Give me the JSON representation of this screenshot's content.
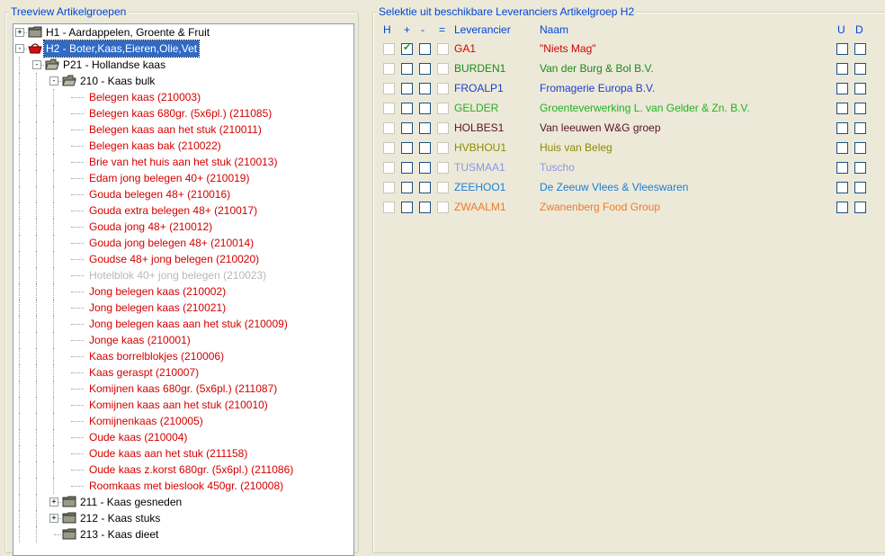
{
  "left_panel": {
    "legend": "Treeview Artikelgroepen",
    "tree": [
      {
        "label": "H1  - Aardappelen, Groente & Fruit",
        "level": 0,
        "expander": "+",
        "icon": "folder-icon",
        "color": "#000000",
        "selected": false
      },
      {
        "label": "H2  - Boter,Kaas,Eieren,Olie,Vet",
        "level": 0,
        "expander": "−",
        "icon": "red-basket-icon",
        "color": "#ffffff",
        "selected": true
      },
      {
        "label": "P21 - Hollandse kaas",
        "level": 1,
        "expander": "−",
        "icon": "open-folder-icon",
        "color": "#000000",
        "selected": false
      },
      {
        "label": "210 - Kaas bulk",
        "level": 2,
        "expander": "−",
        "icon": "open-folder-icon",
        "color": "#000000",
        "selected": false
      },
      {
        "label": "Belegen kaas (210003)",
        "level": 3,
        "color": "#d40000"
      },
      {
        "label": "Belegen kaas 680gr. (5x6pl.) (211085)",
        "level": 3,
        "color": "#d40000"
      },
      {
        "label": "Belegen kaas aan het stuk (210011)",
        "level": 3,
        "color": "#d40000"
      },
      {
        "label": "Belegen kaas bak (210022)",
        "level": 3,
        "color": "#d40000"
      },
      {
        "label": "Brie van het huis aan het stuk (210013)",
        "level": 3,
        "color": "#d40000"
      },
      {
        "label": "Edam jong belegen 40+ (210019)",
        "level": 3,
        "color": "#d40000"
      },
      {
        "label": "Gouda belegen 48+ (210016)",
        "level": 3,
        "color": "#d40000"
      },
      {
        "label": "Gouda extra belegen 48+ (210017)",
        "level": 3,
        "color": "#d40000"
      },
      {
        "label": "Gouda jong 48+ (210012)",
        "level": 3,
        "color": "#d40000"
      },
      {
        "label": "Gouda jong belegen 48+ (210014)",
        "level": 3,
        "color": "#d40000"
      },
      {
        "label": "Goudse 48+ jong belegen (210020)",
        "level": 3,
        "color": "#d40000"
      },
      {
        "label": "Hotelblok 40+ jong belegen (210023)",
        "level": 3,
        "color": "#b8b8b8"
      },
      {
        "label": "Jong belegen kaas (210002)",
        "level": 3,
        "color": "#d40000"
      },
      {
        "label": "Jong belegen kaas (210021)",
        "level": 3,
        "color": "#d40000"
      },
      {
        "label": "Jong belegen kaas aan het stuk (210009)",
        "level": 3,
        "color": "#d40000"
      },
      {
        "label": "Jonge kaas (210001)",
        "level": 3,
        "color": "#d40000"
      },
      {
        "label": "Kaas borrelblokjes (210006)",
        "level": 3,
        "color": "#d40000"
      },
      {
        "label": "Kaas geraspt (210007)",
        "level": 3,
        "color": "#d40000"
      },
      {
        "label": "Komijnen kaas 680gr. (5x6pl.) (211087)",
        "level": 3,
        "color": "#d40000"
      },
      {
        "label": "Komijnen kaas aan het stuk (210010)",
        "level": 3,
        "color": "#d40000"
      },
      {
        "label": "Komijnenkaas (210005)",
        "level": 3,
        "color": "#d40000"
      },
      {
        "label": "Oude kaas (210004)",
        "level": 3,
        "color": "#d40000"
      },
      {
        "label": "Oude kaas aan het stuk (211158)",
        "level": 3,
        "color": "#d40000"
      },
      {
        "label": "Oude kaas z.korst 680gr. (5x6pl.) (211086)",
        "level": 3,
        "color": "#d40000"
      },
      {
        "label": "Roomkaas met bieslook 450gr. (210008)",
        "level": 3,
        "color": "#d40000"
      },
      {
        "label": "211 - Kaas gesneden",
        "level": 2,
        "expander": "+",
        "icon": "folder-icon",
        "color": "#000000",
        "selected": false
      },
      {
        "label": "212 - Kaas stuks",
        "level": 2,
        "expander": "+",
        "icon": "folder-icon",
        "color": "#000000",
        "selected": false
      },
      {
        "label": "213 - Kaas dieet",
        "level": 2,
        "icon": "folder-icon",
        "color": "#000000",
        "selected": false
      }
    ]
  },
  "right_panel": {
    "legend": "Selektie uit beschikbare Leveranciers Artikelgroep H2",
    "columns": {
      "h": "H",
      "plus": "+",
      "minus": "-",
      "eq": "=",
      "leverancier": "Leverancier",
      "naam": "Naam",
      "u": "U",
      "d": "D"
    },
    "rows": [
      {
        "code": "GA1",
        "naam": "\"Niets Mag\"",
        "color": "#d40000",
        "plus_checked": true
      },
      {
        "code": "BURDEN1",
        "naam": "Van der Burg & Bol B.V.",
        "color": "#1a8c1a",
        "plus_checked": false
      },
      {
        "code": "FROALP1",
        "naam": "Fromagerie Europa B.V.",
        "color": "#1c3fd4",
        "plus_checked": false
      },
      {
        "code": "GELDER",
        "naam": "Groenteverwerking L. van Gelder & Zn. B.V.",
        "color": "#22b022",
        "plus_checked": false
      },
      {
        "code": "HOLBES1",
        "naam": "Van leeuwen W&G groep",
        "color": "#5a0f2a",
        "plus_checked": false
      },
      {
        "code": "HVBHOU1",
        "naam": "Huis van Beleg",
        "color": "#8c8c00",
        "plus_checked": false
      },
      {
        "code": "TUSMAA1",
        "naam": "Tuscho",
        "color": "#8a96e6",
        "plus_checked": false
      },
      {
        "code": "ZEEHOO1",
        "naam": "De Zeeuw Vlees & Vleeswaren",
        "color": "#1a7fd6",
        "plus_checked": false
      },
      {
        "code": "ZWAALM1",
        "naam": "Zwanenberg Food Group",
        "color": "#f07a2a",
        "plus_checked": false
      }
    ]
  }
}
